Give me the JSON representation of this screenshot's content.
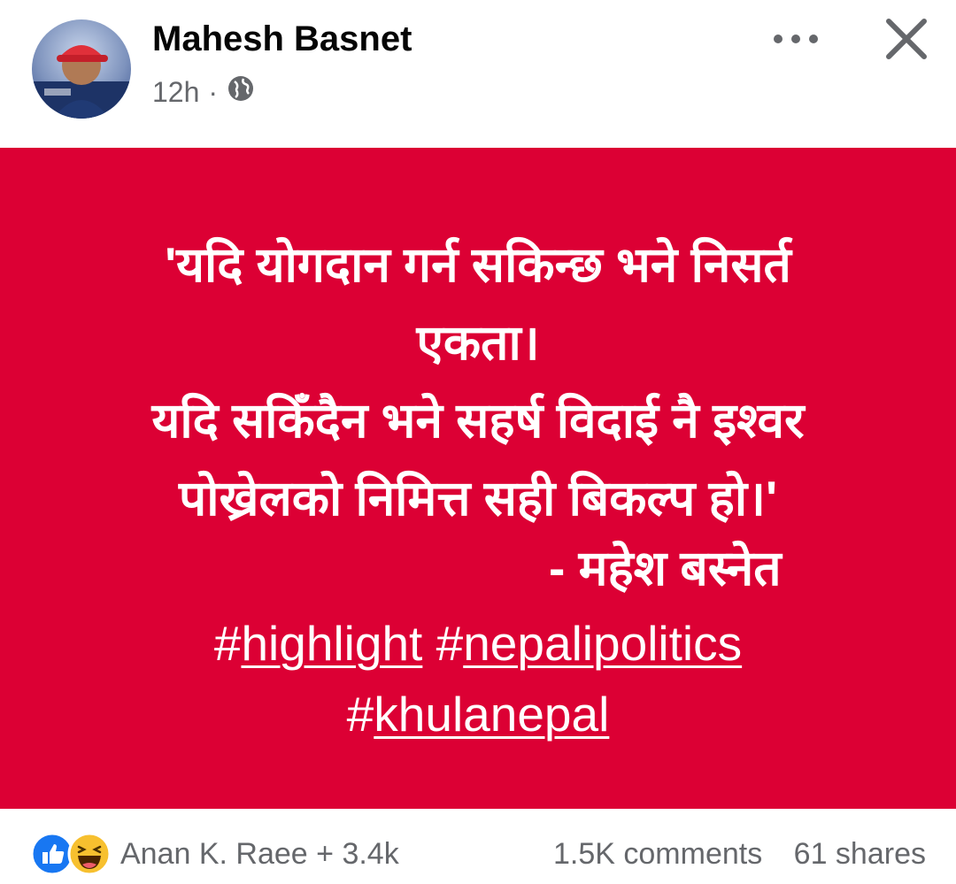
{
  "post": {
    "author": "Mahesh Basnet",
    "time": "12h",
    "separator": "·",
    "privacy_icon": "globe-icon",
    "quote_lines": [
      "'यदि योगदान गर्न सकिन्छ भने निसर्त",
      "एकता।",
      "यदि सकिँदैन भने सहर्ष विदाई नै इश्वर",
      "पोख्रेलको निमित्त सही बिकल्प हो।'"
    ],
    "attribution": "- महेश बस्नेत",
    "hashtags": [
      "highlight",
      "nepalipolitics",
      "khulanepal"
    ],
    "background_color": "#dc0034"
  },
  "header": {
    "more_icon": "more-dots-icon",
    "close_icon": "close-icon"
  },
  "footer": {
    "reactions": [
      "like-icon",
      "haha-icon"
    ],
    "reaction_summary": "Anan K. Raee + 3.4k",
    "comments": "1.5K comments",
    "shares": "61 shares"
  }
}
